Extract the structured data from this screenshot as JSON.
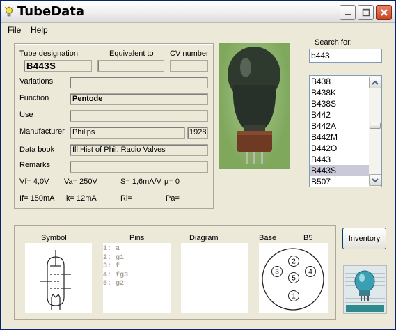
{
  "window": {
    "title": "TubeData"
  },
  "menu": {
    "file": "File",
    "help": "Help"
  },
  "labels": {
    "tube_designation": "Tube designation",
    "equivalent_to": "Equivalent to",
    "cv_number": "CV number",
    "variations": "Variations",
    "function": "Function",
    "use": "Use",
    "manufacturer": "Manufacturer",
    "data_book": "Data book",
    "remarks": "Remarks",
    "search_for": "Search for:",
    "symbol": "Symbol",
    "pins": "Pins",
    "diagram": "Diagram",
    "base": "Base"
  },
  "tube": {
    "designation": "B443S",
    "equivalent": "",
    "cv_number": "",
    "variations": "",
    "function": "Pentode",
    "use": "",
    "manufacturer": "Philips",
    "year": "1928",
    "data_book": "Ill.Hist of Phil. Radio Valves",
    "remarks": "",
    "base_type": "B5"
  },
  "specs": {
    "vf": "Vf= 4,0V",
    "va": "Va=  250V",
    "s": "S= 1,6mA/V",
    "mu": "µ=    0",
    "if": "If= 150mA",
    "ik": "Ik=  12mA",
    "ri": "Ri=",
    "pa": "Pa="
  },
  "search": {
    "value": "b443"
  },
  "list": {
    "items": [
      "B438",
      "B438K",
      "B438S",
      "B442",
      "B442A",
      "B442M",
      "B442O",
      "B443",
      "B443S",
      "B507"
    ],
    "selected": "B443S"
  },
  "pins": [
    "1: a",
    "2: g1",
    "3: f",
    "4: fg3",
    "5: g2"
  ],
  "base_pins": [
    "1",
    "2",
    "3",
    "4",
    "5"
  ],
  "buttons": {
    "inventory": "Inventory"
  },
  "icons": {
    "app": "lightbulb-icon",
    "minimize": "minimize-icon",
    "maximize": "maximize-icon",
    "close": "close-icon",
    "scroll_up": "chevron-up-icon",
    "scroll_down": "chevron-down-icon"
  },
  "colors": {
    "title_bar": "#f2f2f2",
    "close_button": "#c9431f",
    "photo_background": "#8fb56b",
    "selection": "#c9c9d8"
  }
}
